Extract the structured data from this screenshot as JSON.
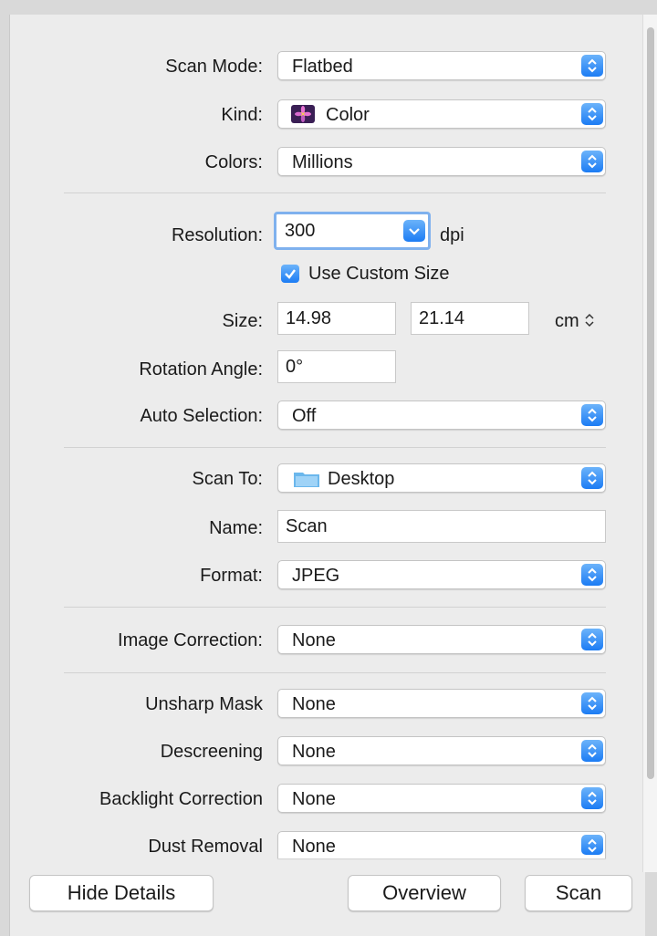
{
  "scan_mode": {
    "label": "Scan Mode:",
    "value": "Flatbed"
  },
  "kind": {
    "label": "Kind:",
    "value": "Color",
    "icon": "color-flower-icon"
  },
  "colors": {
    "label": "Colors:",
    "value": "Millions"
  },
  "resolution": {
    "label": "Resolution:",
    "value": "300",
    "unit": "dpi"
  },
  "custom_size": {
    "label": "Use Custom Size",
    "checked": true
  },
  "size": {
    "label": "Size:",
    "width": "14.98",
    "height": "21.14",
    "unit": "cm"
  },
  "rotation": {
    "label": "Rotation Angle:",
    "value": "0°"
  },
  "auto_selection": {
    "label": "Auto Selection:",
    "value": "Off"
  },
  "scan_to": {
    "label": "Scan To:",
    "value": "Desktop",
    "icon": "folder-icon"
  },
  "name": {
    "label": "Name:",
    "value": "Scan"
  },
  "format": {
    "label": "Format:",
    "value": "JPEG"
  },
  "image_correction": {
    "label": "Image Correction:",
    "value": "None"
  },
  "unsharp_mask": {
    "label": "Unsharp Mask",
    "value": "None"
  },
  "descreening": {
    "label": "Descreening",
    "value": "None"
  },
  "backlight_correction": {
    "label": "Backlight Correction",
    "value": "None"
  },
  "dust_removal": {
    "label": "Dust Removal",
    "value": "None"
  },
  "buttons": {
    "hide_details": "Hide Details",
    "overview": "Overview",
    "scan": "Scan"
  },
  "colors_theme": {
    "accent": "#1c7cf4",
    "panel": "#ececec"
  }
}
